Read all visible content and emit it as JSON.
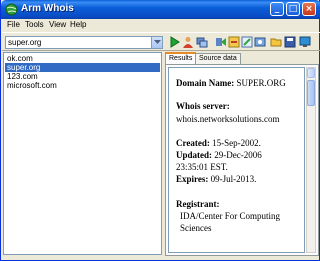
{
  "window": {
    "title": "Arm Whois"
  },
  "menu": {
    "items": [
      "File",
      "Tools",
      "View",
      "Help"
    ]
  },
  "toolbar": {
    "query_value": "super.org"
  },
  "domains": {
    "items": [
      "ok.com",
      "super.org",
      "123.com",
      "microsoft.com"
    ],
    "selected_index": 1
  },
  "tabs": {
    "items": [
      "Results",
      "Source data"
    ],
    "active_index": 0
  },
  "result": {
    "domain_name_label": "Domain Name:",
    "domain_name_value": "SUPER.ORG",
    "whois_server_label": "Whois server:",
    "whois_server_value": "whois.networksolutions.com",
    "created_label": "Created:",
    "created_value": "15-Sep-2002.",
    "updated_label": "Updated:",
    "updated_value": "29-Dec-2006",
    "updated_time": "23:35:01 EST.",
    "expires_label": "Expires:",
    "expires_value": "09-Jul-2013.",
    "registrant_label": "Registrant:",
    "registrant_line1": "IDA/Center For Computing",
    "registrant_line2": "Sciences"
  },
  "icons": [
    "app-globe-icon",
    "minimize-icon",
    "maximize-icon",
    "close-icon",
    "dropdown-arrow-icon",
    "play-icon",
    "person-icon",
    "stack-icon",
    "go-arrow-icon",
    "tool-a-icon",
    "tool-b-icon",
    "tool-c-icon",
    "open-folder-icon",
    "save-icon",
    "monitor-icon"
  ],
  "colors": {
    "titlebar": "#0a5fd8",
    "selection": "#316ac5",
    "active_tab": "#e68b2c"
  }
}
